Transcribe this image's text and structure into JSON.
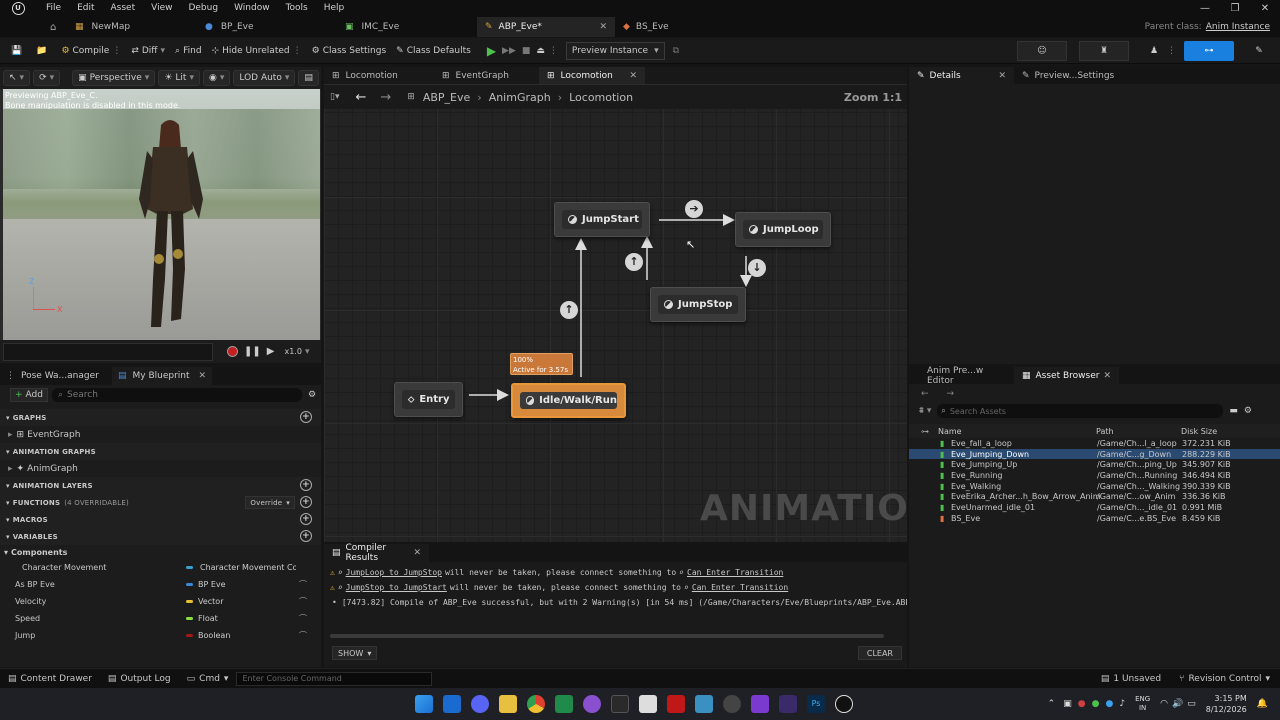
{
  "menu": [
    "File",
    "Edit",
    "Asset",
    "View",
    "Debug",
    "Window",
    "Tools",
    "Help"
  ],
  "window_controls": [
    "—",
    "❐",
    "✕"
  ],
  "tabs": [
    {
      "label": "NewMap"
    },
    {
      "label": "BP_Eve"
    },
    {
      "label": "IMC_Eve"
    },
    {
      "label": "ABP_Eve*"
    },
    {
      "label": "BS_Eve"
    }
  ],
  "parent_class": {
    "label": "Parent class:",
    "value": "Anim Instance"
  },
  "toolbar": {
    "compile": "Compile",
    "diff": "Diff",
    "find": "Find",
    "hide_unrelated": "Hide Unrelated",
    "class_settings": "Class Settings",
    "class_defaults": "Class Defaults",
    "preview_instance": "Preview Instance"
  },
  "viewport": {
    "perspective": "Perspective",
    "lit": "Lit",
    "lod": "LOD Auto",
    "preview_text": "Previewing ABP_Eve_C.",
    "preview_sub": "Bone manipulation is disabled in this mode.",
    "speed": "x1.0",
    "axis_z": "Z",
    "axis_x": "X"
  },
  "left_tabs": [
    "Pose Wa...anager",
    "My Blueprint"
  ],
  "my_blueprint": {
    "add": "Add",
    "search_placeholder": "Search",
    "graphs": "GRAPHS",
    "event_graph": "EventGraph",
    "anim_graphs": "ANIMATION GRAPHS",
    "anim_graph": "AnimGraph",
    "anim_layers": "ANIMATION LAYERS",
    "functions": "FUNCTIONS",
    "functions_count": "(4 OVERRIDABLE)",
    "override": "Override",
    "macros": "MACROS",
    "variables": "VARIABLES",
    "components": "Components",
    "vars": [
      {
        "name": "Character Movement",
        "type": "Character Movement Co",
        "color": "#3aa0d0"
      },
      {
        "name": "As BP Eve",
        "type": "BP Eve",
        "color": "#3a8ad8"
      },
      {
        "name": "Velocity",
        "type": "Vector",
        "color": "#e8c030"
      },
      {
        "name": "Speed",
        "type": "Float",
        "color": "#88e040"
      },
      {
        "name": "Jump",
        "type": "Boolean",
        "color": "#a01818"
      }
    ]
  },
  "graph_tabs": [
    "Locomotion",
    "EventGraph",
    "Locomotion"
  ],
  "breadcrumb": [
    "ABP_Eve",
    "AnimGraph",
    "Locomotion"
  ],
  "zoom": "Zoom 1:1",
  "watermark": "ANIMATION",
  "nodes": {
    "entry": "Entry",
    "idle": "Idle/Walk/Run",
    "jumpstart": "JumpStart",
    "jumploop": "JumpLoop",
    "jumpstop": "JumpStop"
  },
  "active_badge": {
    "pct": "100%",
    "time": "Active for 3.57s"
  },
  "compiler": {
    "tab": "Compiler Results",
    "w1a": "JumpLoop to JumpStop",
    "w1b": "will never be taken, please connect something to",
    "w1c": "Can Enter Transition",
    "w2a": "JumpStop to JumpStart",
    "w2b": "will never be taken, please connect something to",
    "w2c": "Can Enter Transition",
    "info": "[7473.82] Compile of ABP_Eve successful, but with 2 Warning(s) [in 54 ms] (/Game/Characters/Eve/Blueprints/ABP_Eve.ABP_E",
    "show": "SHOW",
    "clear": "CLEAR"
  },
  "right_tabs": [
    "Details",
    "Preview...Settings"
  ],
  "asset_tabs": [
    "Anim Pre...w Editor",
    "Asset Browser"
  ],
  "asset_browser": {
    "search_placeholder": "Search Assets",
    "cols": [
      "Name",
      "Path",
      "Disk Size"
    ],
    "rows": [
      {
        "name": "Eve_fall_a_loop",
        "path": "/Game/Ch...l_a_loop",
        "size": "372.231 KiB",
        "selected": false
      },
      {
        "name": "Eve_Jumping_Down",
        "path": "/Game/C...g_Down",
        "size": "288.229 KiB",
        "selected": true
      },
      {
        "name": "Eve_Jumping_Up",
        "path": "/Game/Ch...ping_Up",
        "size": "345.907 KiB",
        "selected": false
      },
      {
        "name": "Eve_Running",
        "path": "/Game/Ch...Running",
        "size": "346.494 KiB",
        "selected": false
      },
      {
        "name": "Eve_Walking",
        "path": "/Game/Ch..._Walking",
        "size": "390.339 KiB",
        "selected": false
      },
      {
        "name": "EveErika_Archer...h_Bow_Arrow_Anim",
        "path": "/Game/C...ow_Anim",
        "size": "336.36 KiB",
        "selected": false
      },
      {
        "name": "EveUnarmed_idle_01",
        "path": "/Game/Ch..._idle_01",
        "size": "0.991 MiB",
        "selected": false
      },
      {
        "name": "BS_Eve",
        "path": "/Game/C...e.BS_Eve",
        "size": "8.459 KiB",
        "selected": false
      }
    ]
  },
  "statusbar": {
    "content_drawer": "Content Drawer",
    "output_log": "Output Log",
    "cmd": "Cmd",
    "console_placeholder": "Enter Console Command",
    "unsaved": "1 Unsaved",
    "revision": "Revision Control"
  },
  "taskbar": {
    "lang1": "ENG",
    "lang2": "IN",
    "time": "3:15 PM",
    "date": "8/12/2026"
  }
}
